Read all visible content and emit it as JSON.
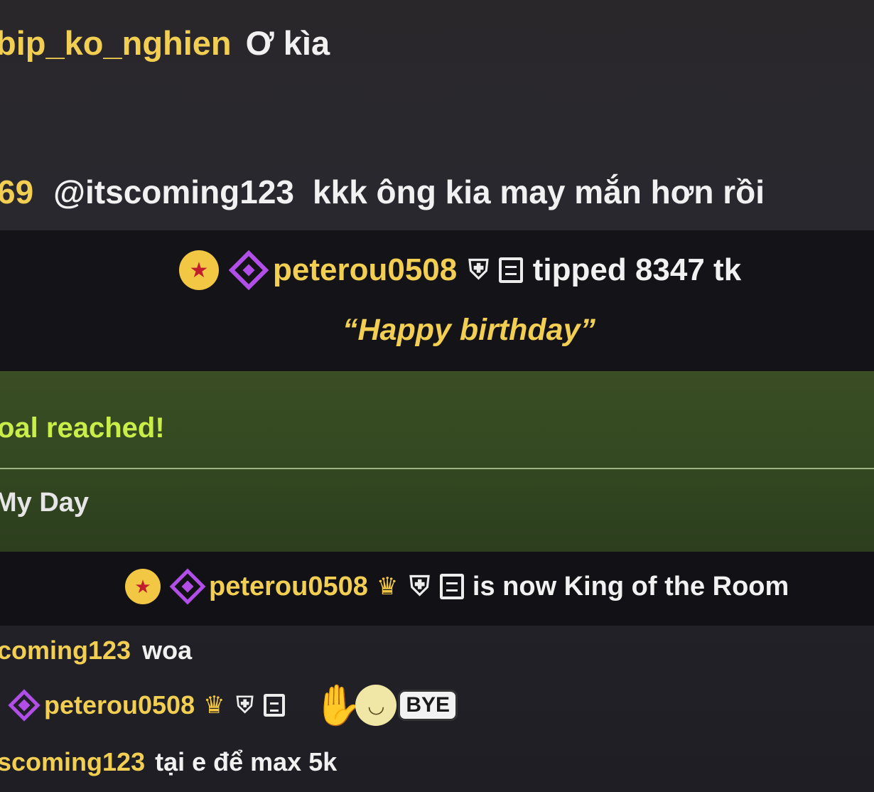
{
  "chat": {
    "message1": {
      "user": "bip_ko_nghien",
      "text": "Ơ kìa"
    },
    "message2": {
      "user": "69",
      "mention": "@itscoming123",
      "text": "kkk ông kia may mắn hơn rồi"
    },
    "tip": {
      "badge_icon": "star-badge-icon",
      "rank_icon": "diamond-icon",
      "user": "peterou0508",
      "action": "tipped 8347 tk",
      "note": "“Happy birthday”"
    },
    "goal": {
      "title": "oal reached!",
      "name": "My Day"
    },
    "king": {
      "user": "peterou0508",
      "text": "is now King of the Room"
    },
    "message3": {
      "user": "coming123",
      "text": "woa"
    },
    "message4": {
      "user": "peterou0508",
      "emote_label": "BYE"
    },
    "message5": {
      "user": "scoming123",
      "text": "tại e để max 5k"
    }
  },
  "colors": {
    "username": "#f2cf52",
    "goal_text": "#c9ee4a",
    "badge_gold": "#f2c744",
    "badge_purple": "#b24ee8"
  }
}
